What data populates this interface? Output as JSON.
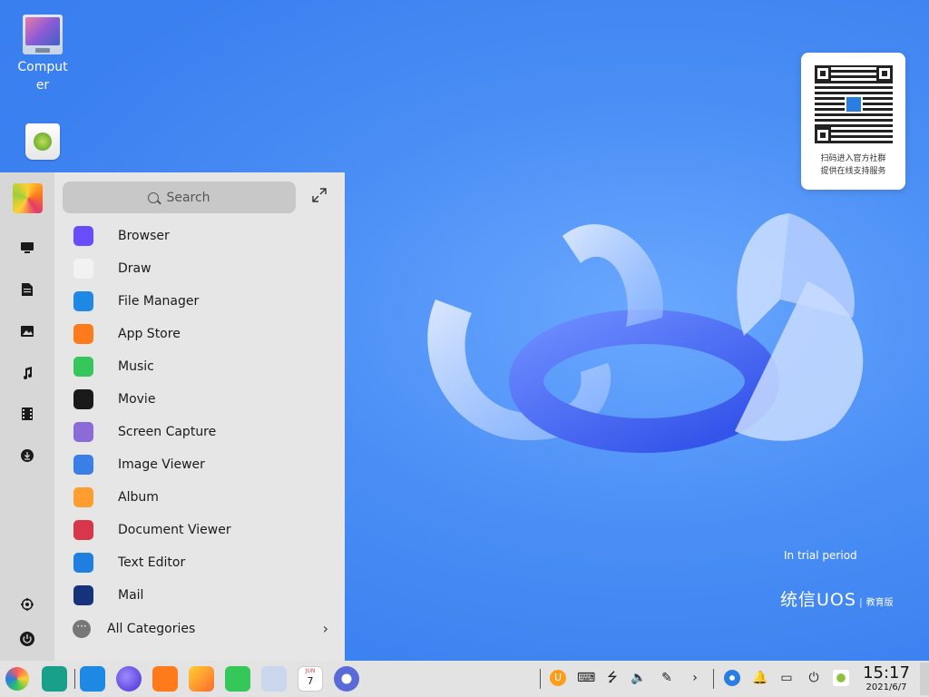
{
  "desktop": {
    "icons": [
      {
        "label": "Computer",
        "icon": "computer-icon"
      },
      {
        "label": "",
        "icon": "trash-icon"
      }
    ],
    "qr_card": {
      "line1": "扫码进入官方社群",
      "line2": "提供在线支持服务"
    },
    "trial_text": "In trial period",
    "brand": {
      "name": "统信UOS",
      "separator": "|",
      "edition": "教育版"
    }
  },
  "launcher": {
    "search_placeholder": "Search",
    "sidebar": [
      {
        "icon": "avatar-icon"
      },
      {
        "icon": "computer-icon"
      },
      {
        "icon": "document-icon"
      },
      {
        "icon": "picture-icon"
      },
      {
        "icon": "music-note-icon"
      },
      {
        "icon": "film-icon"
      },
      {
        "icon": "download-icon"
      },
      {
        "icon": "settings-gear-icon"
      },
      {
        "icon": "power-icon"
      }
    ],
    "apps": [
      {
        "label": "Browser",
        "color": "#6a4cff"
      },
      {
        "label": "Draw",
        "color": "#f2f2f2"
      },
      {
        "label": "File Manager",
        "color": "#1e88e5"
      },
      {
        "label": "App Store",
        "color": "#ff7a1a"
      },
      {
        "label": "Music",
        "color": "#35c759"
      },
      {
        "label": "Movie",
        "color": "#1a1a1a"
      },
      {
        "label": "Screen Capture",
        "color": "#8a6bd8"
      },
      {
        "label": "Image Viewer",
        "color": "#3a7ee8"
      },
      {
        "label": "Album",
        "color": "#ff9d2e"
      },
      {
        "label": "Document Viewer",
        "color": "#d8364a"
      },
      {
        "label": "Text Editor",
        "color": "#1f7fe0"
      },
      {
        "label": "Mail",
        "color": "#15337a"
      }
    ],
    "all_categories": "All Categories"
  },
  "taskbar": {
    "apps": [
      {
        "icon": "launcher-icon",
        "color": "#f0f0f0"
      },
      {
        "icon": "multitask-view-icon",
        "color": "#19a08a"
      },
      {
        "icon": "file-manager-icon",
        "color": "#1e88e5"
      },
      {
        "icon": "browser-icon",
        "color": "#6a4cff"
      },
      {
        "icon": "app-store-icon",
        "color": "#ff7a1a"
      },
      {
        "icon": "album-icon",
        "color": "#ff9d2e"
      },
      {
        "icon": "music-icon",
        "color": "#35c759"
      },
      {
        "icon": "contacts-icon",
        "color": "#9aaed0"
      },
      {
        "icon": "calendar-icon",
        "color": "#ffffff"
      },
      {
        "icon": "control-center-icon",
        "color": "#5a6bd8"
      }
    ],
    "calendar_month": "JUN",
    "calendar_day": "7",
    "tray": [
      "input-method-icon",
      "keyboard-icon",
      "usb-icon",
      "volume-icon",
      "pen-icon",
      "chevron-right-icon",
      "network-icon",
      "notification-bell-icon",
      "keyboard-layout-icon",
      "power-icon",
      "trash-icon"
    ],
    "clock_time": "15:17",
    "clock_date": "2021/6/7"
  }
}
